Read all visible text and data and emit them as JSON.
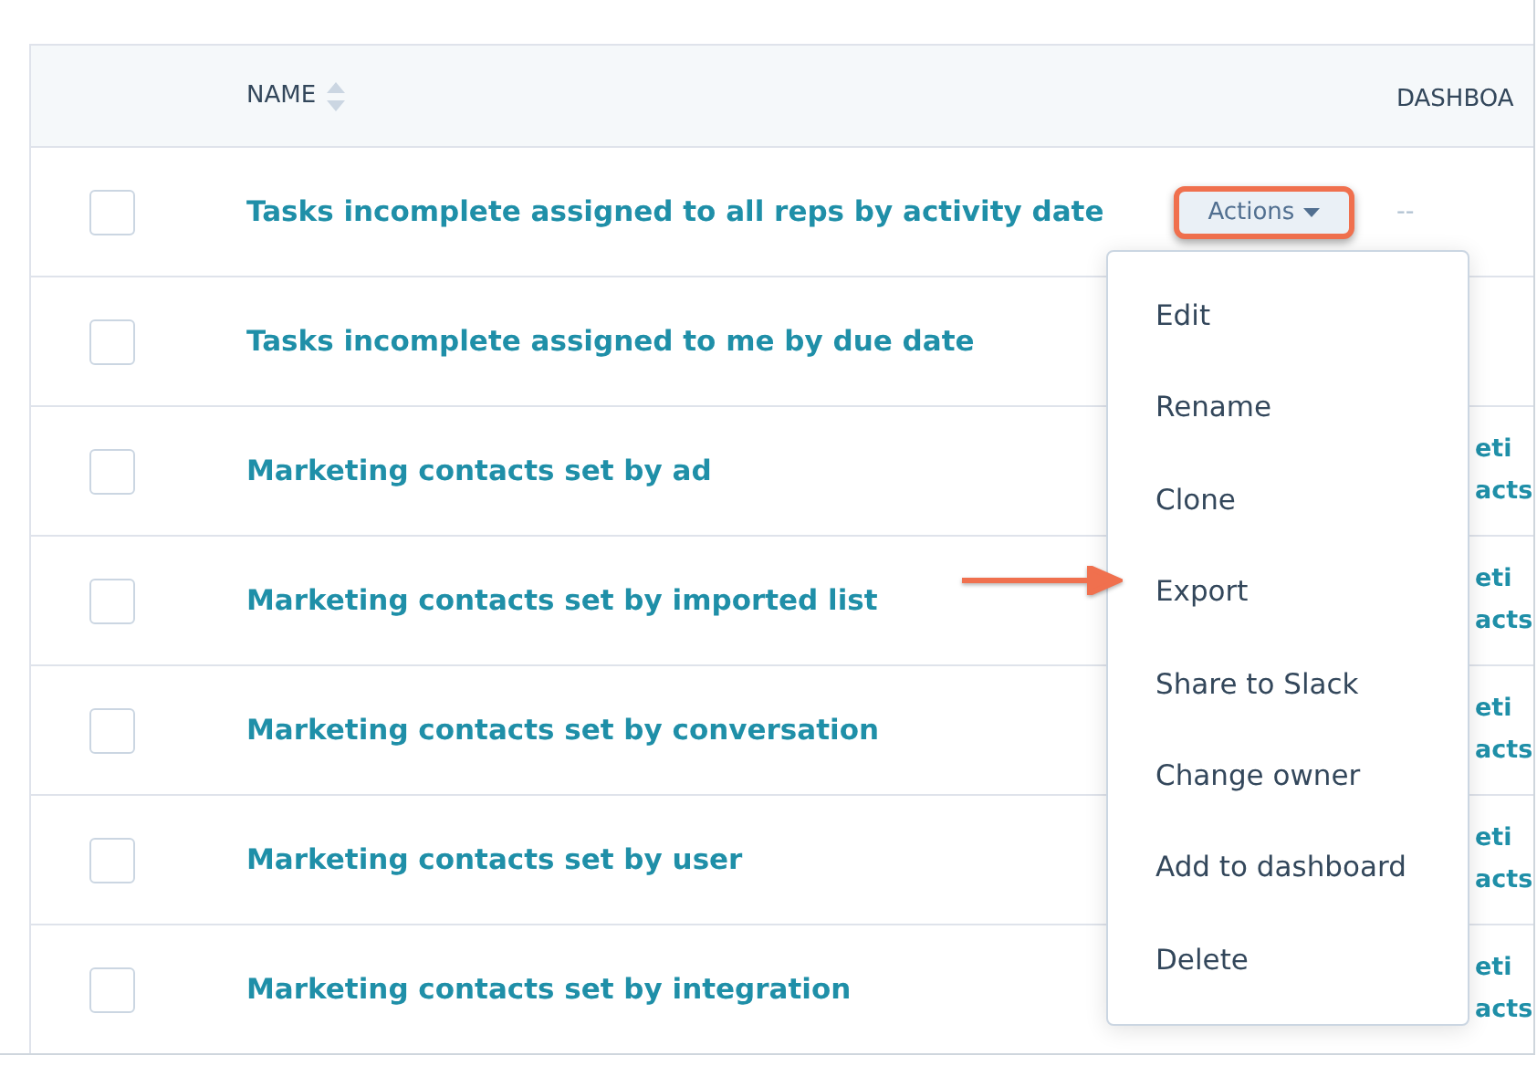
{
  "table": {
    "columns": [
      {
        "label": "NAME"
      },
      {
        "label": "DASHBOA"
      }
    ],
    "rows": [
      {
        "name": "Tasks incomplete assigned to all reps by activity date",
        "checked": false,
        "dashboard": [
          "--"
        ],
        "actions_button": {
          "label": "Actions",
          "highlighted": true
        }
      },
      {
        "name": "Tasks incomplete assigned to me by due date",
        "checked": false,
        "dashboard": []
      },
      {
        "name": "Marketing contacts set by ad",
        "checked": false,
        "dashboard": [
          "eti",
          "acts"
        ]
      },
      {
        "name": "Marketing contacts set by imported list",
        "checked": false,
        "dashboard": [
          "eti",
          "acts"
        ]
      },
      {
        "name": "Marketing contacts set by conversation",
        "checked": false,
        "dashboard": [
          "eti",
          "acts"
        ]
      },
      {
        "name": "Marketing contacts set by user",
        "checked": false,
        "dashboard": [
          "eti",
          "acts"
        ]
      },
      {
        "name": "Marketing contacts set by integration",
        "checked": false,
        "dashboard": [
          "eti",
          "acts"
        ]
      }
    ]
  },
  "actions_menu": {
    "items": [
      {
        "label": "Edit",
        "pointed": false
      },
      {
        "label": "Rename",
        "pointed": false
      },
      {
        "label": "Clone",
        "pointed": false
      },
      {
        "label": "Export",
        "pointed": true
      },
      {
        "label": "Share to Slack",
        "pointed": false
      },
      {
        "label": "Change owner",
        "pointed": false
      },
      {
        "label": "Add to dashboard",
        "pointed": false
      },
      {
        "label": "Delete",
        "pointed": false
      }
    ]
  }
}
